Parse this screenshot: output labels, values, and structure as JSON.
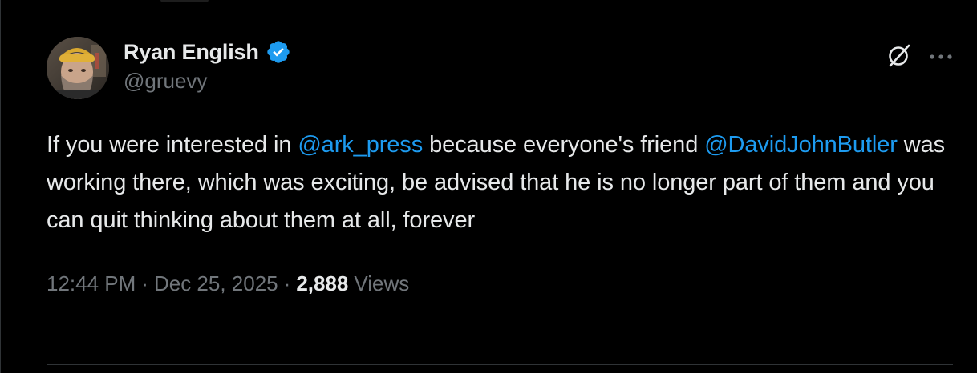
{
  "tweet": {
    "author": {
      "display_name": "Ryan English",
      "handle": "@gruevy",
      "verified": true,
      "verified_color": "#1d9bf0"
    },
    "text": {
      "part1": "If you were interested in ",
      "mention1": "@ark_press",
      "part2": " because everyone's friend ",
      "mention2": "@DavidJohnButler",
      "part3": " was working there, which was exciting, be advised that he is no longer part of them and you can quit thinking about them at all, forever"
    },
    "meta": {
      "time": "12:44 PM",
      "sep1": "·",
      "date": "Dec 25, 2025",
      "sep2": "·",
      "views_count": "2,888",
      "views_label": "Views"
    },
    "actions": {
      "grok_icon": "grok-icon",
      "more_icon": "more-icon"
    }
  },
  "colors": {
    "background": "#000000",
    "text": "#e7e9ea",
    "secondary_text": "#71767b",
    "link": "#1d9bf0",
    "border": "#2f3336"
  }
}
